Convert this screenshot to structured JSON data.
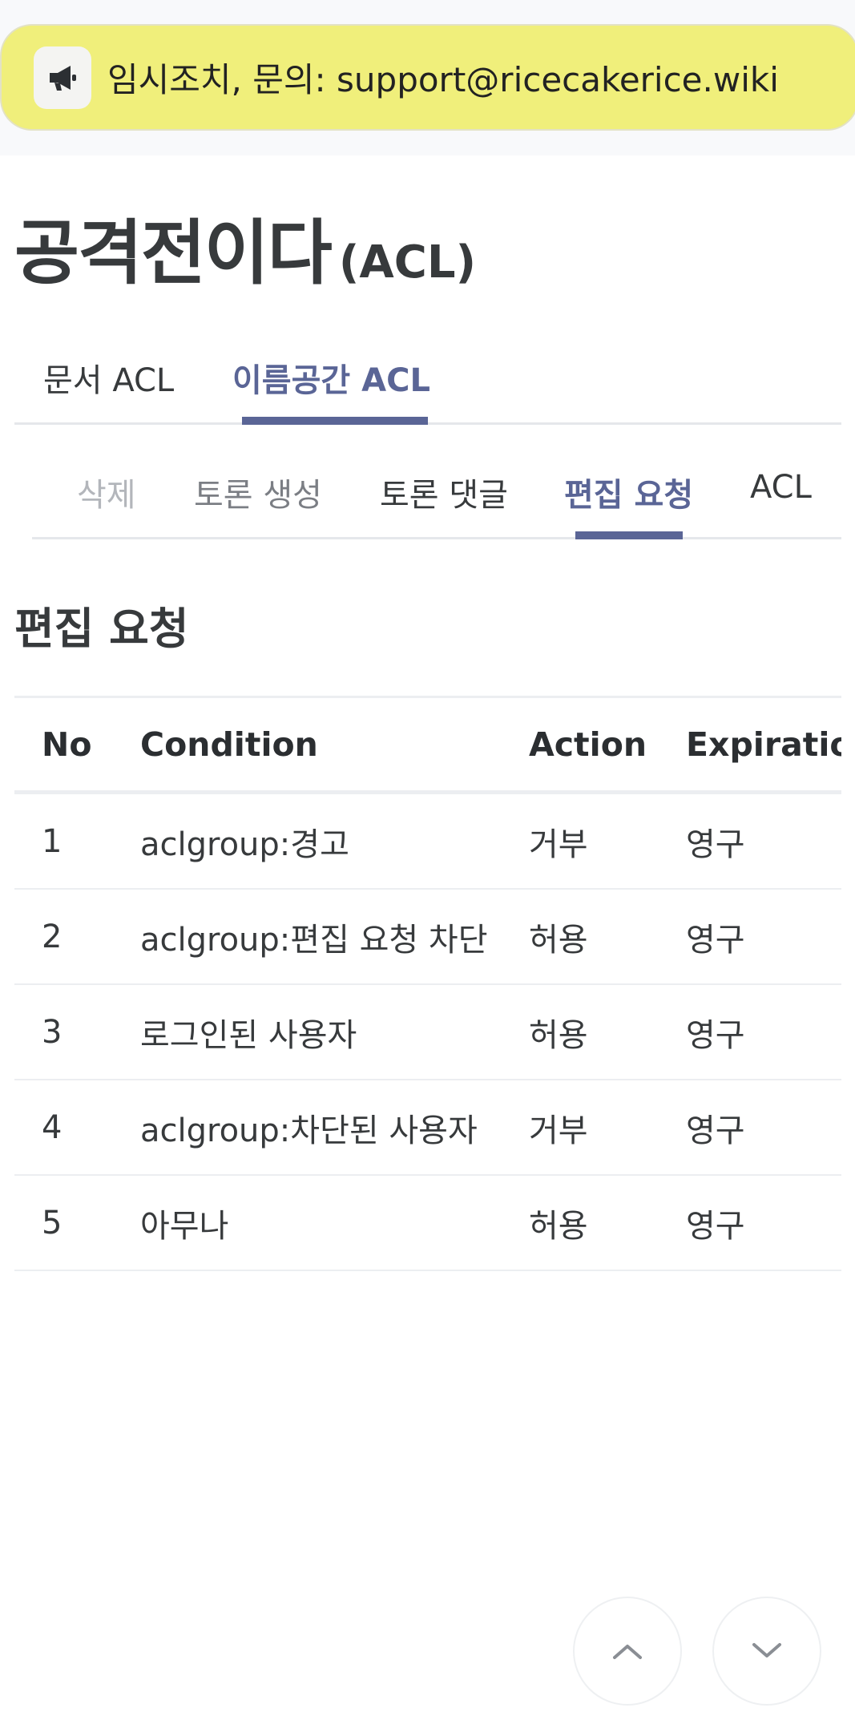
{
  "notice": {
    "icon": "megaphone-icon",
    "text": "임시조치, 문의: support@ricecakerice.wiki",
    "bg_color": "#f0ef7b"
  },
  "title": {
    "main": "공격전이다",
    "sub": "(ACL)"
  },
  "main_tabs": {
    "doc": "문서 ACL",
    "namespace": "이름공간 ACL",
    "active": "namespace"
  },
  "sub_tabs": {
    "delete": "삭제",
    "create_thread": "토론 생성",
    "write_thread_comment": "토론 댓글",
    "edit_request": "편집 요청",
    "acl": "ACL",
    "active": "edit_request"
  },
  "section": {
    "title": "편집 요청"
  },
  "table": {
    "headers": {
      "no": "No",
      "condition": "Condition",
      "action": "Action",
      "expiration": "Expiration"
    },
    "rows": [
      {
        "no": "1",
        "condition": "aclgroup:경고",
        "action": "거부",
        "expiration": "영구"
      },
      {
        "no": "2",
        "condition": "aclgroup:편집 요청 차단",
        "action": "허용",
        "expiration": "영구"
      },
      {
        "no": "3",
        "condition": "로그인된 사용자",
        "action": "허용",
        "expiration": "영구"
      },
      {
        "no": "4",
        "condition": "aclgroup:차단된 사용자",
        "action": "거부",
        "expiration": "영구"
      },
      {
        "no": "5",
        "condition": "아무나",
        "action": "허용",
        "expiration": "영구"
      }
    ]
  },
  "scroll_buttons": {
    "up_icon": "chevron-up-icon",
    "down_icon": "chevron-down-icon"
  },
  "colors": {
    "accent": "#5a6596",
    "text": "#373a3c",
    "muted": "#b3b6bb",
    "border": "#eceef1"
  }
}
